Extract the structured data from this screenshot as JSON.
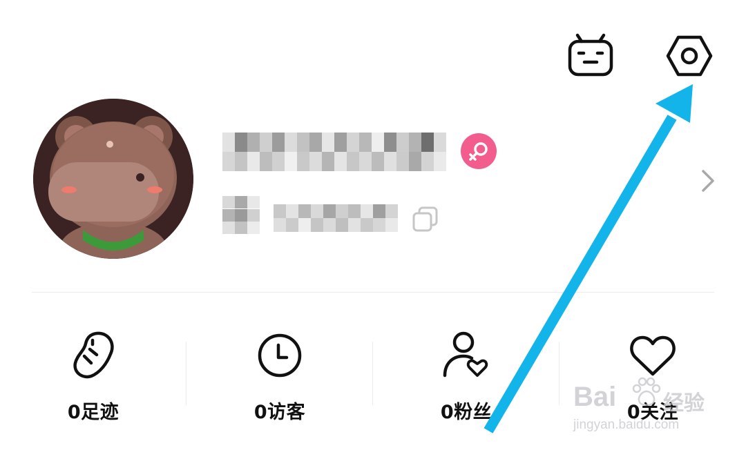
{
  "header": {
    "icons": [
      "robot-tv-icon",
      "settings-hexagon-icon"
    ]
  },
  "profile": {
    "username_blurred": true,
    "user_id_blurred": true,
    "gender": "female",
    "gender_color": "#f25d8e",
    "icons": [
      "copy-icon",
      "chevron-right-icon"
    ]
  },
  "stats": [
    {
      "label": "0足迹",
      "icon": "footprint-icon"
    },
    {
      "label": "0访客",
      "icon": "clock-icon"
    },
    {
      "label": "0粉丝",
      "icon": "user-heart-icon"
    },
    {
      "label": "0关注",
      "icon": "heart-icon"
    }
  ],
  "watermark": {
    "brand": "Bai",
    "brand_suffix": "经验",
    "url": "jingyan.baidu.com"
  },
  "annotation": {
    "arrow_color": "#12b4ea",
    "points_to": "settings-hexagon-icon"
  }
}
